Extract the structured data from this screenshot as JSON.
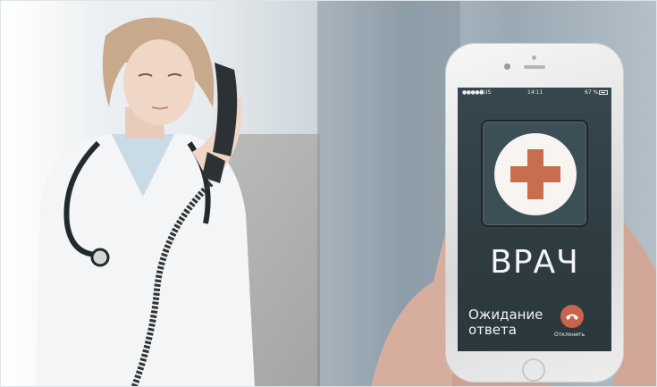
{
  "photo": {
    "subject": "doctor on a desk phone; hand holding a smartphone showing an incoming call screen"
  },
  "phone": {
    "status_bar": {
      "signal": "●●●●●",
      "carrier": "RUS",
      "time": "14:11",
      "battery": "67 %"
    },
    "caller_name": "ВРАЧ",
    "call_status_line1": "Ожидание",
    "call_status_line2": "ответа",
    "decline_label": "Отклонить",
    "colors": {
      "screen": "#37474f",
      "cross": "#c96d4f",
      "decline": "#c6654a"
    }
  }
}
